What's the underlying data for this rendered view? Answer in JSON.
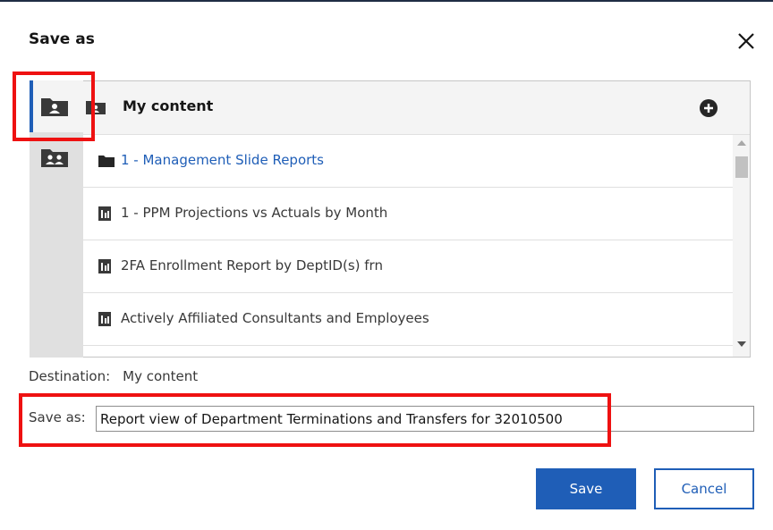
{
  "dialog": {
    "title": "Save as"
  },
  "panel": {
    "title": "My content",
    "items": [
      {
        "label": "1 - Management Slide Reports",
        "kind": "folder"
      },
      {
        "label": "1 - PPM Projections vs Actuals by Month",
        "kind": "report"
      },
      {
        "label": "2FA Enrollment Report by DeptID(s) frn",
        "kind": "report"
      },
      {
        "label": "Actively Affiliated Consultants and Employees",
        "kind": "report"
      }
    ]
  },
  "rail": {
    "items": [
      {
        "icon": "my-content-folder-icon",
        "active": true
      },
      {
        "icon": "team-content-folder-icon",
        "active": false
      }
    ]
  },
  "destination": {
    "label": "Destination:",
    "value": "My content"
  },
  "save_as": {
    "label": "Save as:",
    "value": "Report view of Department Terminations and Transfers for 32010500"
  },
  "buttons": {
    "save": "Save",
    "cancel": "Cancel"
  },
  "colors": {
    "accent": "#1f5eb7",
    "highlight": "#ee1111"
  }
}
